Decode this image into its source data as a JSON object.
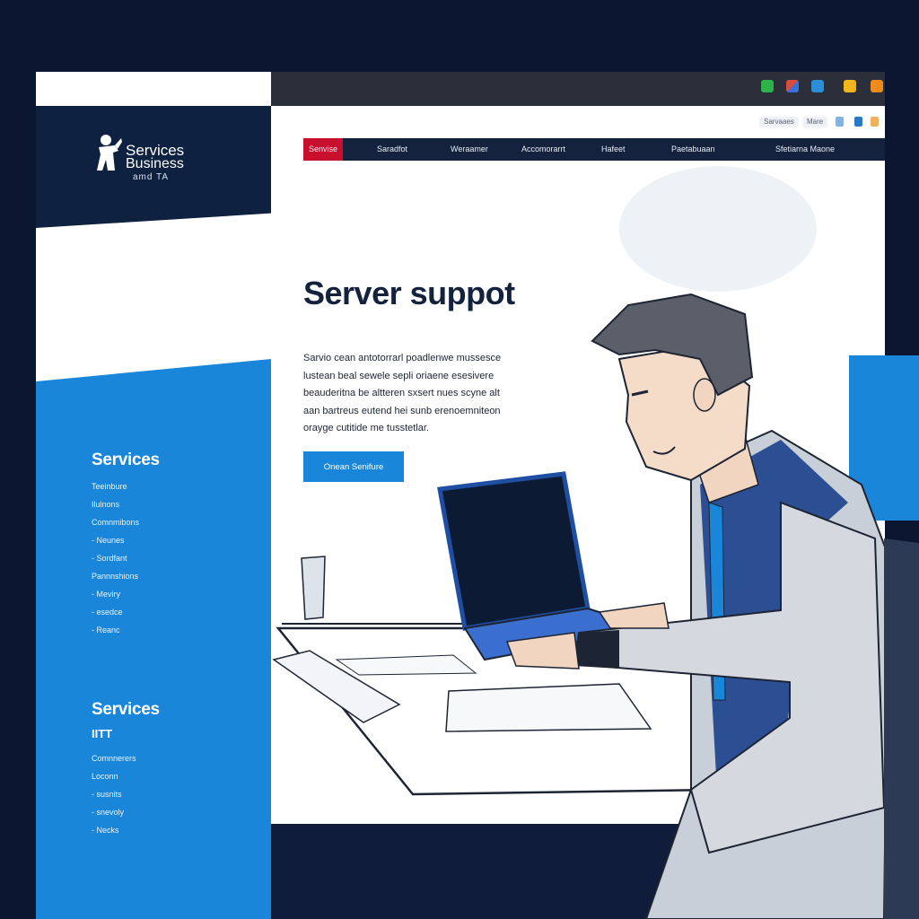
{
  "brand": {
    "line1": "Services",
    "line2": "Business",
    "line3": "amd TA"
  },
  "topbar": {
    "icons": [
      {
        "name": "green-app-icon",
        "color": "#2fb24a"
      },
      {
        "name": "multicolor-app-icon",
        "color": "#d94b3c"
      },
      {
        "name": "blue-app-icon",
        "color": "#2a8fd8"
      },
      {
        "name": "yellow-app-icon",
        "color": "#f2b51c"
      },
      {
        "name": "orange-app-icon",
        "color": "#f08a1a"
      }
    ]
  },
  "utility": {
    "search_label": "Sarvaaes",
    "more_label": "Mare"
  },
  "nav": {
    "items": [
      {
        "label": "Senvise",
        "active": true
      },
      {
        "label": "Saradfot"
      },
      {
        "label": "Weraamer"
      },
      {
        "label": "Accomorarrt"
      },
      {
        "label": "Hafeet"
      },
      {
        "label": "Paetabuaan"
      },
      {
        "label": "Sfetiarna Maone"
      }
    ]
  },
  "hero": {
    "title": "Server suppot",
    "body_lines": [
      "Sarvio cean antotorrarl poadlenwe mussesce",
      "lustean beal sewele sepli oriaene esesivere",
      "beauderitna be altteren sxsert nues scyne alt",
      "aan bartreus eutend hei sunb erenoemniteon",
      "orayge cutitide me tusstetlar."
    ],
    "cta_label": "Onean Senifure"
  },
  "sidebar": {
    "group1": {
      "title": "Services",
      "items": [
        "Teeinbure",
        "Ilulnons",
        "Comnmibons",
        "- Neunes",
        "- Sordfant",
        "Pannnshions",
        "- Meviry",
        "- esedce",
        "- Reanc"
      ]
    },
    "group2": {
      "title": "Services",
      "subtitle": "IITT",
      "items": [
        "Comnnerers",
        "Loconn",
        "- susnits",
        "- snevoly",
        "- Necks"
      ]
    }
  },
  "colors": {
    "page_bg": "#0b1630",
    "navy": "#14223e",
    "accent_blue": "#1a86d9",
    "active_red": "#c8102e"
  }
}
